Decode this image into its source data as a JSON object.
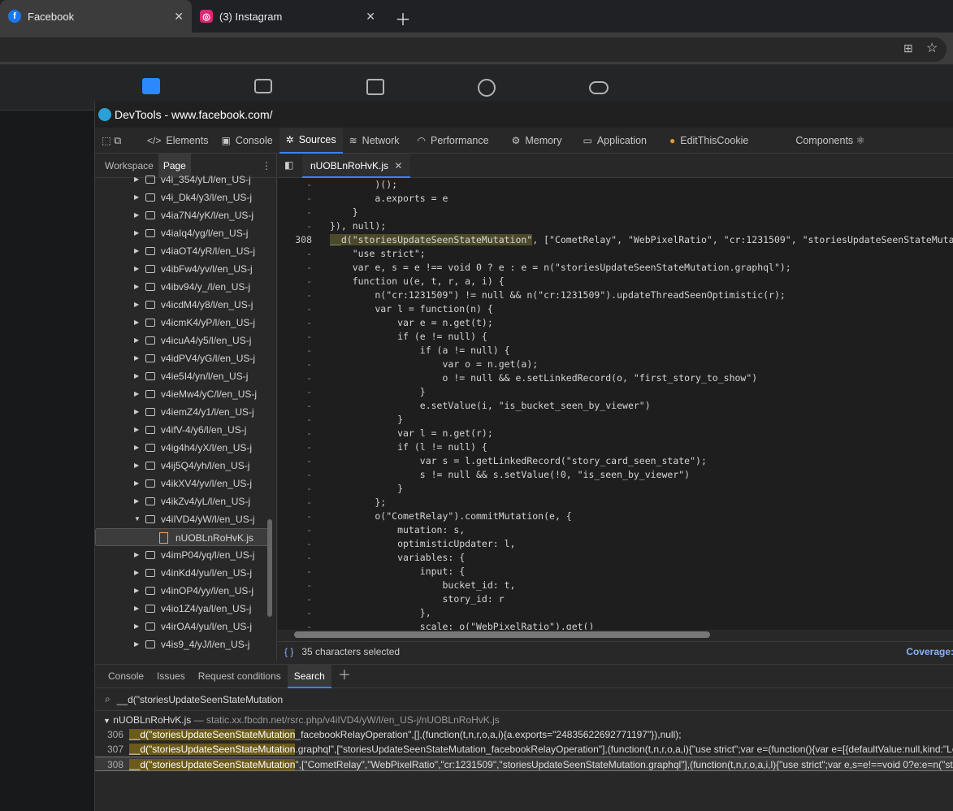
{
  "browser": {
    "tabs": [
      {
        "title": "Facebook",
        "active": true
      },
      {
        "title": "(3) Instagram",
        "active": false
      }
    ]
  },
  "devtools": {
    "title": "DevTools - www.facebook.com/",
    "tools": [
      "Elements",
      "Console",
      "Sources",
      "Network",
      "Performance",
      "Memory",
      "Application",
      "EditThisCookie",
      "Components ⚛"
    ],
    "active_tool": "Sources",
    "navigator_tabs": [
      "Workspace",
      "Page"
    ],
    "tree": [
      "v4i_354/yL/l/en_US-j",
      "v4i_Dk4/y3/l/en_US-j",
      "v4ia7N4/yK/l/en_US-j",
      "v4iaIq4/yg/l/en_US-j",
      "v4iaOT4/yR/l/en_US-j",
      "v4ibFw4/yv/l/en_US-j",
      "v4ibv94/y_/l/en_US-j",
      "v4icdM4/y8/l/en_US-j",
      "v4icmK4/yP/l/en_US-j",
      "v4icuA4/y5/l/en_US-j",
      "v4idPV4/yG/l/en_US-j",
      "v4ie5I4/yn/l/en_US-j",
      "v4ieMw4/yC/l/en_US-j",
      "v4iemZ4/y1/l/en_US-j",
      "v4ifV-4/y6/l/en_US-j",
      "v4ig4h4/yX/l/en_US-j",
      "v4ij5Q4/yh/l/en_US-j",
      "v4ikXV4/yv/l/en_US-j",
      "v4ikZv4/yL/l/en_US-j",
      "v4iIVD4/yW/l/en_US-j",
      "nUOBLnRoHvK.js",
      "v4imP04/yq/l/en_US-j",
      "v4inKd4/yu/l/en_US-j",
      "v4inOP4/yy/l/en_US-j",
      "v4io1Z4/ya/l/en_US-j",
      "v4irOA4/yu/l/en_US-j",
      "v4is9_4/yJ/l/en_US-j"
    ],
    "editor_tab": "nUOBLnRoHvK.js",
    "code_lines": [
      {
        "n": "-",
        "t": "        )();"
      },
      {
        "n": "-",
        "t": "        a.exports = e"
      },
      {
        "n": "-",
        "t": "    }"
      },
      {
        "n": "-",
        "t": "}), null);"
      },
      {
        "n": "308",
        "t": "__d(\"storiesUpdateSeenStateMutation\", [\"CometRelay\", \"WebPixelRatio\", \"cr:1231509\", \"storiesUpdateSeenStateMutation.g"
      },
      {
        "n": "-",
        "t": "    \"use strict\";"
      },
      {
        "n": "-",
        "t": "    var e, s = e !== void 0 ? e : e = n(\"storiesUpdateSeenStateMutation.graphql\");"
      },
      {
        "n": "-",
        "t": "    function u(e, t, r, a, i) {"
      },
      {
        "n": "-",
        "t": "        n(\"cr:1231509\") != null && n(\"cr:1231509\").updateThreadSeenOptimistic(r);"
      },
      {
        "n": "-",
        "t": "        var l = function(n) {"
      },
      {
        "n": "-",
        "t": "            var e = n.get(t);"
      },
      {
        "n": "-",
        "t": "            if (e != null) {"
      },
      {
        "n": "-",
        "t": "                if (a != null) {"
      },
      {
        "n": "-",
        "t": "                    var o = n.get(a);"
      },
      {
        "n": "-",
        "t": "                    o != null && e.setLinkedRecord(o, \"first_story_to_show\")"
      },
      {
        "n": "-",
        "t": "                }"
      },
      {
        "n": "-",
        "t": "                e.setValue(i, \"is_bucket_seen_by_viewer\")"
      },
      {
        "n": "-",
        "t": "            }"
      },
      {
        "n": "-",
        "t": "            var l = n.get(r);"
      },
      {
        "n": "-",
        "t": "            if (l != null) {"
      },
      {
        "n": "-",
        "t": "                var s = l.getLinkedRecord(\"story_card_seen_state\");"
      },
      {
        "n": "-",
        "t": "                s != null && s.setValue(!0, \"is_seen_by_viewer\")"
      },
      {
        "n": "-",
        "t": "            }"
      },
      {
        "n": "-",
        "t": "        };"
      },
      {
        "n": "-",
        "t": "        o(\"CometRelay\").commitMutation(e, {"
      },
      {
        "n": "-",
        "t": "            mutation: s,"
      },
      {
        "n": "-",
        "t": "            optimisticUpdater: l,"
      },
      {
        "n": "-",
        "t": "            variables: {"
      },
      {
        "n": "-",
        "t": "                input: {"
      },
      {
        "n": "-",
        "t": "                    bucket_id: t,"
      },
      {
        "n": "-",
        "t": "                    story_id: r"
      },
      {
        "n": "-",
        "t": "                },"
      },
      {
        "n": "-",
        "t": "                scale: o(\"WebPixelRatio\").get()"
      }
    ],
    "status_text": "35 characters selected",
    "coverage_label": "Coverage:",
    "drawer_tabs": [
      "Console",
      "Issues",
      "Request conditions",
      "Search"
    ],
    "active_drawer_tab": "Search",
    "search_query": "__d(\"storiesUpdateSeenStateMutation",
    "result_file": "nUOBLnRoHvK.js",
    "result_path": "— static.xx.fbcdn.net/rsrc.php/v4iIVD4/yW/l/en_US-j/nUOBLnRoHvK.js",
    "results": [
      {
        "line": "306",
        "match": "__d(\"storiesUpdateSeenStateMutation",
        "rest": "_facebookRelayOperation\",[],(function(t,n,r,o,a,i){a.exports=\"24835622692771197\"}),null);"
      },
      {
        "line": "307",
        "match": "__d(\"storiesUpdateSeenStateMutation",
        "rest": ".graphql\",[\"storiesUpdateSeenStateMutation_facebookRelayOperation\"],(function(t,n,r,o,a,i){\"use strict\";var e=(function(){var e=[{defaultValue:null,kind:\"Loca"
      },
      {
        "line": "308",
        "match": "__d(\"storiesUpdateSeenStateMutation",
        "rest": "\",[\"CometRelay\",\"WebPixelRatio\",\"cr:1231509\",\"storiesUpdateSeenStateMutation.graphql\"],(function(t,n,r,o,a,i,l){\"use strict\";var e,s=e!==void 0?e:e=n(\"storie"
      }
    ]
  }
}
